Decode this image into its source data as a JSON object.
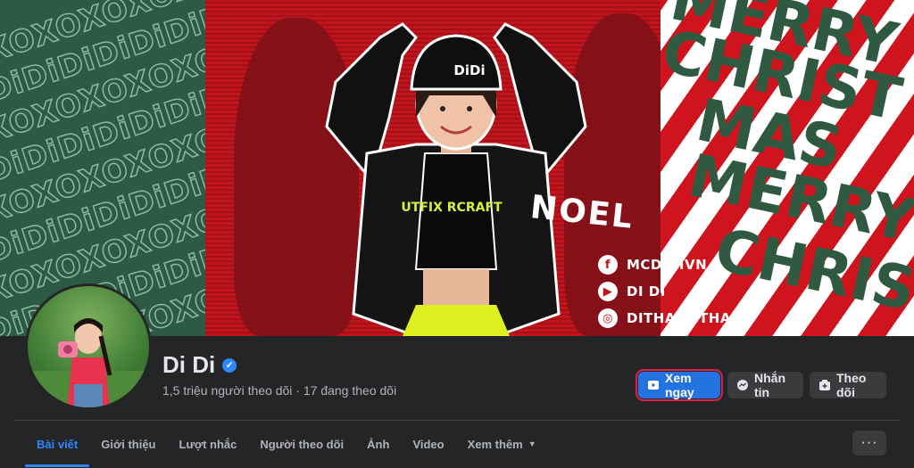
{
  "cover": {
    "pattern_text": [
      "XOXO",
      "DiDi"
    ],
    "xmas_words": [
      "MERRY",
      "CHRIST",
      "MAS",
      "MERRY",
      "CHRIS"
    ],
    "cap_text": "DiDi",
    "shirt_text": "UTFIX RCRAFT",
    "noel_text": "NOEL",
    "socials": [
      {
        "icon": "facebook-icon",
        "glyph": "f",
        "label": "MCDIDIVN"
      },
      {
        "icon": "youtube-icon",
        "glyph": "▶",
        "label": "DI DI"
      },
      {
        "icon": "instagram-icon",
        "glyph": "◎",
        "label": "DITHANHTHANH"
      }
    ],
    "colors": {
      "red": "#c3121b",
      "green": "#2d5a45",
      "white": "#ffffff"
    }
  },
  "profile": {
    "name": "Di Di",
    "verified_glyph": "✓",
    "stats": "1,5 triệu người theo dõi · 17 đang theo dõi"
  },
  "actions": {
    "watch_label": "Xem ngay",
    "message_label": "Nhắn tin",
    "follow_label": "Theo dõi"
  },
  "tabs": [
    {
      "label": "Bài viết",
      "active": true
    },
    {
      "label": "Giới thiệu"
    },
    {
      "label": "Lượt nhắc"
    },
    {
      "label": "Người theo dõi"
    },
    {
      "label": "Ảnh"
    },
    {
      "label": "Video"
    },
    {
      "label": "Xem thêm",
      "dropdown": true
    }
  ],
  "more_glyph": "···",
  "accent": "#2d88ff"
}
